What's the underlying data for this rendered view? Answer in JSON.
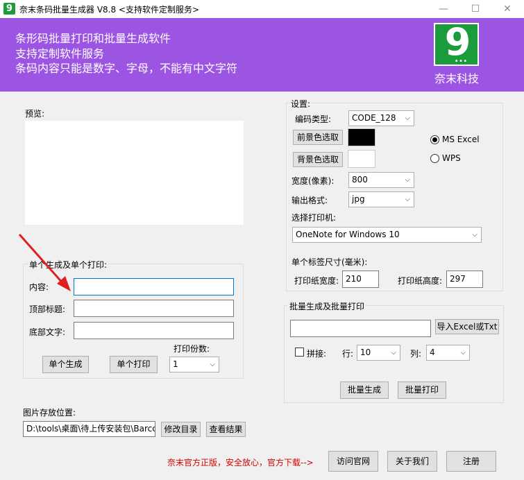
{
  "window": {
    "title": "奈末条码批量生成器 V8.8  <支持软件定制服务>",
    "app_icon_glyph": "9",
    "controls": {
      "minimize": "—",
      "maximize": "☐",
      "close": "✕"
    }
  },
  "banner": {
    "line1": "条形码批量打印和批量生成软件",
    "line2": "支持定制软件服务",
    "line3": "条码内容只能是数字、字母，不能有中文字符",
    "logo_glyph": "9",
    "logo_dots": "...",
    "logo_text": "奈末科技",
    "bg_color": "#9c55e3",
    "logo_color": "#1c9b3c"
  },
  "preview": {
    "label": "预览:"
  },
  "single": {
    "group_title": "单个生成及单个打印:",
    "content_label": "内容:",
    "content_value": "",
    "top_title_label": "顶部标题:",
    "top_title_value": "",
    "bottom_text_label": "底部文字:",
    "bottom_text_value": "",
    "copies_label": "打印份数:",
    "copies_value": "1",
    "generate_button": "单个生成",
    "print_button": "单个打印"
  },
  "image_location": {
    "label": "图片存放位置:",
    "path": "D:\\tools\\桌面\\待上传安装包\\Barcc",
    "change_button": "修改目录",
    "view_button": "查看结果"
  },
  "settings": {
    "group_title": "设置:",
    "encoding_label": "编码类型:",
    "encoding_value": "CODE_128",
    "fg_button": "前景色选取",
    "fg_color": "#000000",
    "bg_button": "背景色选取",
    "bg_color": "#ffffff",
    "radio_ms_excel": "MS  Excel",
    "radio_wps": "WPS",
    "width_label": "宽度(像素):",
    "width_value": "800",
    "format_label": "输出格式:",
    "format_value": "jpg",
    "printer_label": "选择打印机:",
    "printer_value": "OneNote for Windows 10",
    "label_size_label": "单个标签尺寸(毫米):",
    "paper_width_label": "打印纸宽度:",
    "paper_width_value": "210",
    "paper_height_label": "打印纸高度:",
    "paper_height_value": "297"
  },
  "batch": {
    "group_title": "批量生成及批量打印",
    "file_value": "",
    "import_button": "导入Excel或Txt",
    "splice_label": "拼接:",
    "row_label": "行:",
    "row_value": "10",
    "col_label": "列:",
    "col_value": "4",
    "generate_button": "批量生成",
    "print_button": "批量打印"
  },
  "footer": {
    "notice": "奈末官方正版，安全放心，官方下载-->",
    "visit_button": "访问官网",
    "about_button": "关于我们",
    "register_button": "注册"
  }
}
